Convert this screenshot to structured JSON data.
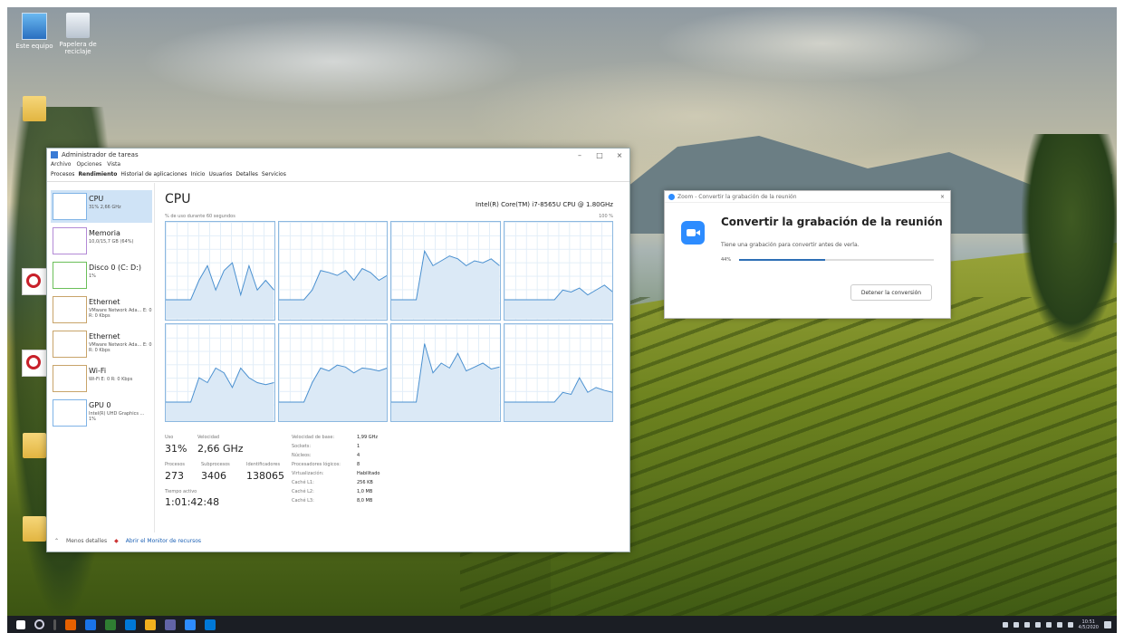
{
  "desktop_icons": [
    {
      "label": "Este equipo",
      "type": "computer"
    },
    {
      "label": "Papelera de reciclaje",
      "type": "recycle"
    }
  ],
  "task_manager": {
    "window_title": "Administrador de tareas",
    "menu": [
      "Archivo",
      "Opciones",
      "Vista"
    ],
    "tabs": [
      "Procesos",
      "Rendimiento",
      "Historial de aplicaciones",
      "Inicio",
      "Usuarios",
      "Detalles",
      "Servicios"
    ],
    "active_tab": "Rendimiento",
    "sidebar": [
      {
        "name": "CPU",
        "sub": "31% 2,66 GHz"
      },
      {
        "name": "Memoria",
        "sub": "10,0/15,7 GB (64%)"
      },
      {
        "name": "Disco 0 (C: D:)",
        "sub": "1%"
      },
      {
        "name": "Ethernet",
        "sub": "VMware Network Ada... E: 0 R: 0 Kbps"
      },
      {
        "name": "Ethernet",
        "sub": "VMware Network Ada... E: 0 R: 0 Kbps"
      },
      {
        "name": "Wi-Fi",
        "sub": "Wi-Fi E: 0 R: 0 Kbps"
      },
      {
        "name": "GPU 0",
        "sub": "Intel(R) UHD Graphics ... 1%"
      }
    ],
    "cpu": {
      "title": "CPU",
      "model": "Intel(R) Core(TM) i7-8565U CPU @ 1.80GHz",
      "util_label": "% de uso durante 60 segundos",
      "max_pct": "100 %",
      "stats": {
        "uso_label": "Uso",
        "uso": "31%",
        "vel_label": "Velocidad",
        "vel": "2,66 GHz",
        "proc_label": "Procesos",
        "proc": "273",
        "sub_label": "Subprocesos",
        "sub": "3406",
        "ident_label": "Identificadores",
        "ident": "138065",
        "time_label": "Tiempo activo",
        "time": "1:01:42:48"
      },
      "details": [
        {
          "k": "Velocidad de base:",
          "v": "1,99 GHz"
        },
        {
          "k": "Sockets:",
          "v": "1"
        },
        {
          "k": "Núcleos:",
          "v": "4"
        },
        {
          "k": "Procesadores lógicos:",
          "v": "8"
        },
        {
          "k": "Virtualización:",
          "v": "Habilitado"
        },
        {
          "k": "Caché L1:",
          "v": "256 KB"
        },
        {
          "k": "Caché L2:",
          "v": "1,0 MB"
        },
        {
          "k": "Caché L3:",
          "v": "8,0 MB"
        }
      ],
      "graphs": [
        [
          80,
          80,
          80,
          80,
          60,
          45,
          70,
          50,
          42,
          75,
          45,
          70,
          60,
          70
        ],
        [
          80,
          80,
          80,
          80,
          70,
          50,
          52,
          55,
          50,
          60,
          48,
          52,
          60,
          55
        ],
        [
          80,
          80,
          80,
          80,
          30,
          45,
          40,
          35,
          38,
          45,
          40,
          42,
          38,
          45
        ],
        [
          80,
          80,
          80,
          80,
          80,
          80,
          80,
          70,
          72,
          68,
          75,
          70,
          65,
          72
        ],
        [
          80,
          80,
          80,
          80,
          55,
          60,
          45,
          50,
          65,
          45,
          55,
          60,
          62,
          60
        ],
        [
          80,
          80,
          80,
          80,
          60,
          45,
          48,
          42,
          44,
          50,
          45,
          46,
          48,
          45
        ],
        [
          80,
          80,
          80,
          80,
          20,
          50,
          40,
          45,
          30,
          48,
          44,
          40,
          46,
          44
        ],
        [
          80,
          80,
          80,
          80,
          80,
          80,
          80,
          70,
          72,
          55,
          70,
          65,
          68,
          70
        ]
      ]
    },
    "footer": {
      "less": "Menos detalles",
      "monitor": "Abrir el Monitor de recursos"
    }
  },
  "zoom_dialog": {
    "title": "Zoom - Convertir la grabación de la reunión",
    "heading": "Convertir la grabación de la reunión",
    "message": "Tiene una grabación para convertir antes de verla.",
    "progress_pct": 44,
    "progress_label": "44%",
    "cancel_button": "Detener la conversión"
  },
  "taskbar": {
    "clock_time": "10:51",
    "clock_date": "4/5/2020",
    "app_colors": [
      "#e66000",
      "#1a73e8",
      "#2f7d32",
      "#0078d7",
      "#f2b01e",
      "#6264a7",
      "#2d8cff",
      "#0078d7"
    ]
  }
}
